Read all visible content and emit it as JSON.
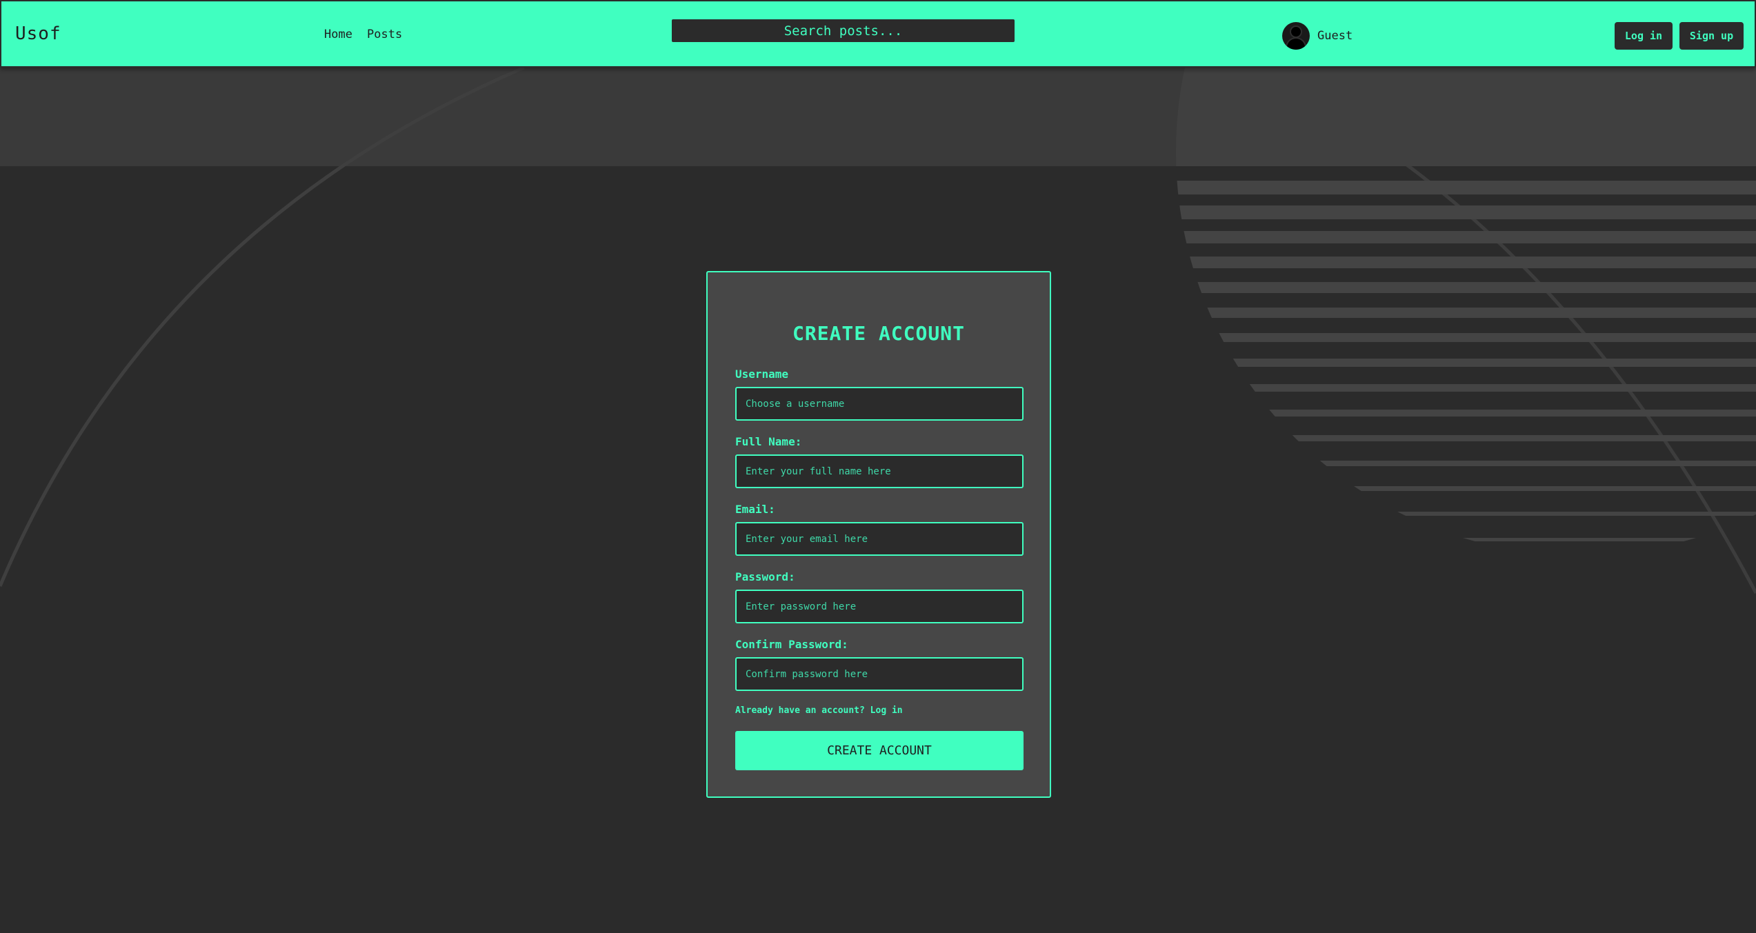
{
  "header": {
    "logo": "Usof",
    "nav": [
      {
        "label": "Home"
      },
      {
        "label": "Posts"
      }
    ],
    "search_placeholder": "Search posts...",
    "user_name": "Guest",
    "login_label": "Log in",
    "signup_label": "Sign up"
  },
  "form": {
    "title": "CREATE ACCOUNT",
    "fields": [
      {
        "label": "Username",
        "placeholder": "Choose a username",
        "value": ""
      },
      {
        "label": "Full Name:",
        "placeholder": "Enter your full name here",
        "value": ""
      },
      {
        "label": "Email:",
        "placeholder": "Enter your email here",
        "value": ""
      },
      {
        "label": "Password:",
        "placeholder": "Enter password here",
        "value": ""
      },
      {
        "label": "Confirm Password:",
        "placeholder": "Confirm password here",
        "value": ""
      }
    ],
    "login_link": "Already have an account? Log in",
    "submit_label": "CREATE ACCOUNT"
  },
  "colors": {
    "accent": "#40ffc0",
    "background": "#2b2b2b",
    "card": "#474747"
  },
  "icons": {
    "avatar": "user-avatar-icon"
  }
}
